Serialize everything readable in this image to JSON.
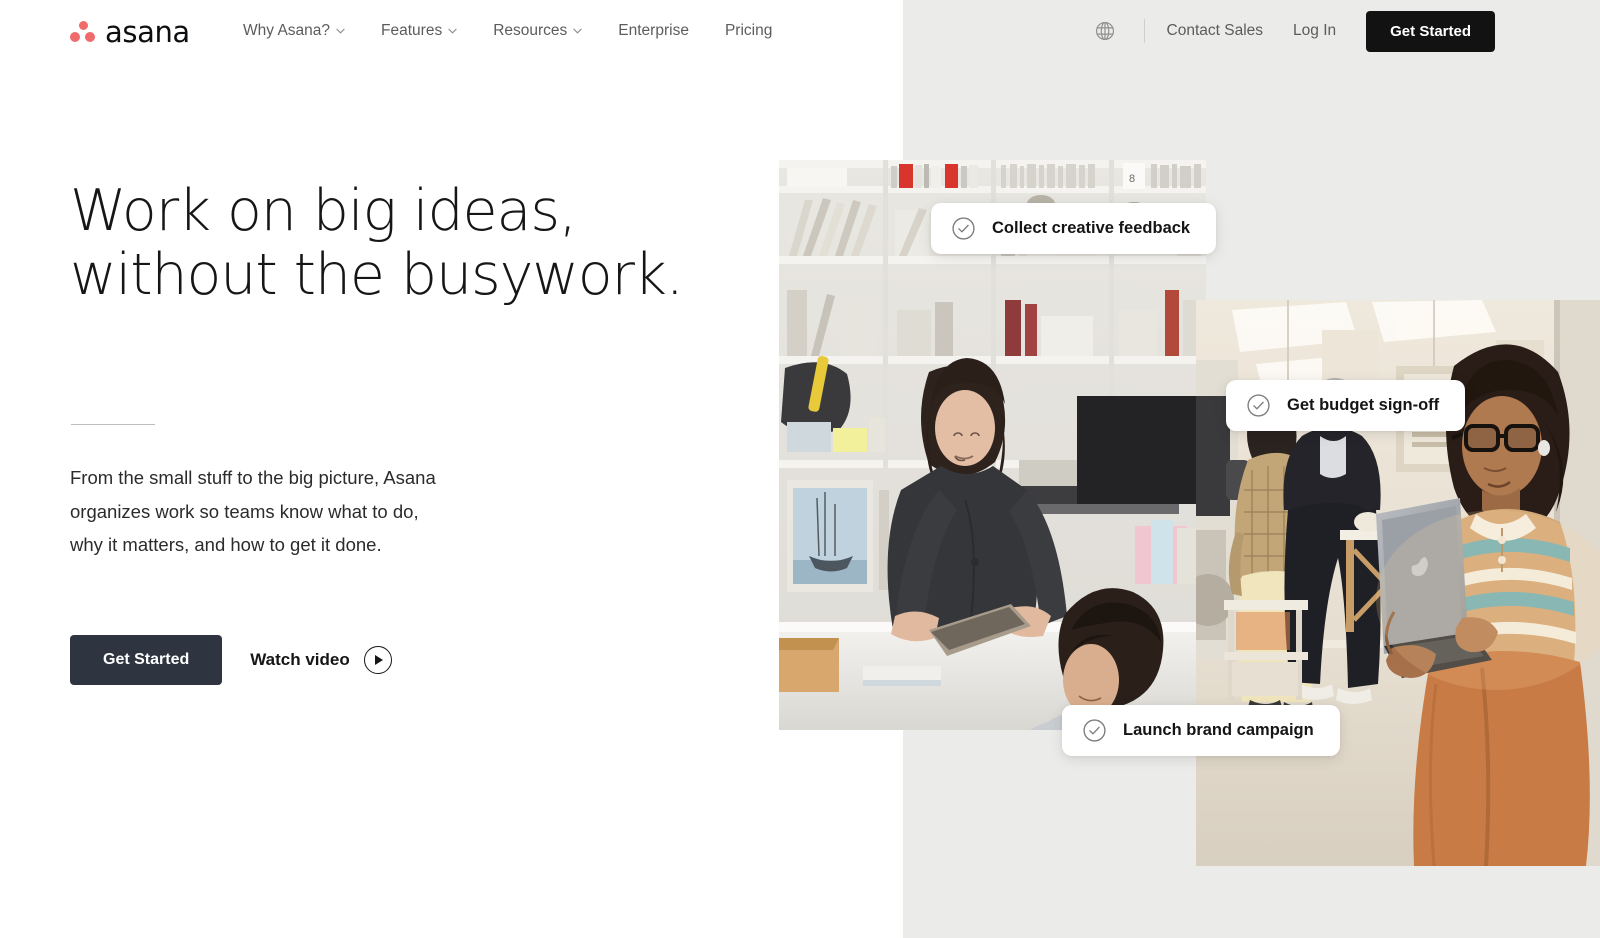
{
  "brand": {
    "name": "asana",
    "logo_icon": "asana-dots-logo",
    "dot_color": "#f06a6a"
  },
  "nav": {
    "links": [
      {
        "label": "Why Asana?",
        "has_dropdown": true
      },
      {
        "label": "Features",
        "has_dropdown": true
      },
      {
        "label": "Resources",
        "has_dropdown": true
      },
      {
        "label": "Enterprise",
        "has_dropdown": false
      },
      {
        "label": "Pricing",
        "has_dropdown": false
      }
    ],
    "language_icon": "globe-icon",
    "contact_sales": "Contact Sales",
    "log_in": "Log In",
    "get_started": "Get Started",
    "get_started_bg": "#121212"
  },
  "hero": {
    "title": "Work on big ideas,\nwithout the busywork.",
    "subtitle": "From the small stuff to the big picture, Asana\norganizes work so teams know what to do,\nwhy it matters, and how to get it done.",
    "primary_cta": "Get Started",
    "primary_cta_bg": "#2e3440",
    "secondary_cta": "Watch video",
    "secondary_cta_icon": "play-circle-icon"
  },
  "cards": [
    {
      "label": "Collect creative feedback",
      "icon": "check-circle-icon"
    },
    {
      "label": "Get budget sign-off",
      "icon": "check-circle-icon"
    },
    {
      "label": "Launch brand campaign",
      "icon": "check-circle-icon"
    }
  ],
  "photos": [
    {
      "alt": "Two coworkers reviewing materials at a desk in a design studio with shelving",
      "name": "hero-photo-studio"
    },
    {
      "alt": "Woman with glasses holding a laptop in a bright workshop space",
      "name": "hero-photo-workshop"
    }
  ],
  "theme": {
    "background_left": "#ffffff",
    "background_right": "#ebebe9",
    "text_primary": "#161616",
    "text_muted": "#5c5c5c"
  }
}
